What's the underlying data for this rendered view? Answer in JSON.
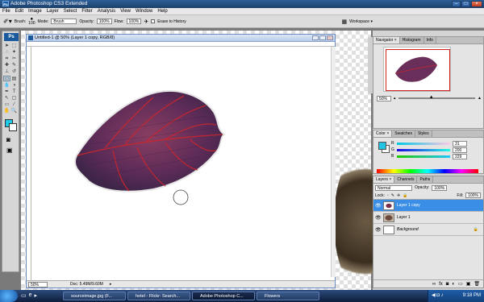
{
  "app": {
    "title": "Adobe Photoshop CS3 Extended",
    "badge": "Ps"
  },
  "menu": [
    "File",
    "Edit",
    "Image",
    "Layer",
    "Select",
    "Filter",
    "Analysis",
    "View",
    "Window",
    "Help"
  ],
  "options": {
    "brush_label": "Brush:",
    "brush_size": "100",
    "mode_label": "Mode:",
    "mode_value": "Brush",
    "opacity_label": "Opacity:",
    "opacity_value": "100%",
    "flow_label": "Flow:",
    "flow_value": "100%",
    "erase_history": "Erase to History",
    "workspace": "Workspace ▾"
  },
  "document": {
    "title": "Untitled-1 @ 50% (Layer 1 copy, RGB/8)",
    "zoom": "50%",
    "doc_info": "Doc: 5.49M/9.60M"
  },
  "navigator": {
    "tabs": [
      "Navigator ×",
      "Histogram",
      "Info"
    ],
    "zoom": "50%"
  },
  "color": {
    "tabs": [
      "Color ×",
      "Swatches",
      "Styles"
    ],
    "channels": [
      {
        "label": "R",
        "value": "31"
      },
      {
        "label": "G",
        "value": "200"
      },
      {
        "label": "B",
        "value": "229"
      }
    ],
    "foreground": "#1fc8e5"
  },
  "layers": {
    "tabs": [
      "Layers ×",
      "Channels",
      "Paths"
    ],
    "blend_mode": "Normal",
    "opacity_label": "Opacity:",
    "opacity_value": "100%",
    "lock_label": "Lock:",
    "fill_label": "Fill:",
    "fill_value": "100%",
    "items": [
      {
        "name": "Layer 1 copy",
        "selected": true
      },
      {
        "name": "Layer 1",
        "selected": false
      },
      {
        "name": "Background",
        "selected": false
      }
    ]
  },
  "taskbar": {
    "items": [
      "sourceimage.jpg (F...",
      "hotel - Flickr: Search...",
      "Adobe Photoshop C...",
      "Flowers"
    ],
    "clock": "9:18 PM"
  }
}
